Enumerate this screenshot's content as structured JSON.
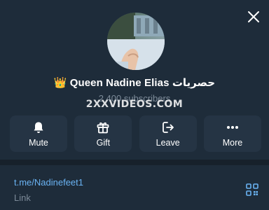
{
  "channel": {
    "title_emoji": "👑",
    "title": "Queen Nadine Elias حصريات",
    "subscribers": "2 400 subscribers"
  },
  "watermark": "2XXVIDEOS.COM",
  "actions": [
    {
      "label": "Mute",
      "icon": "bell-icon"
    },
    {
      "label": "Gift",
      "icon": "gift-icon"
    },
    {
      "label": "Leave",
      "icon": "leave-icon"
    },
    {
      "label": "More",
      "icon": "more-dots-icon"
    }
  ],
  "link": {
    "url": "t.me/Nadinefeet1",
    "label": "Link"
  },
  "colors": {
    "background": "#17212b",
    "panel": "#1e2c3a",
    "button": "#253444",
    "link": "#6ab3f3",
    "muted": "#7d8b99"
  }
}
